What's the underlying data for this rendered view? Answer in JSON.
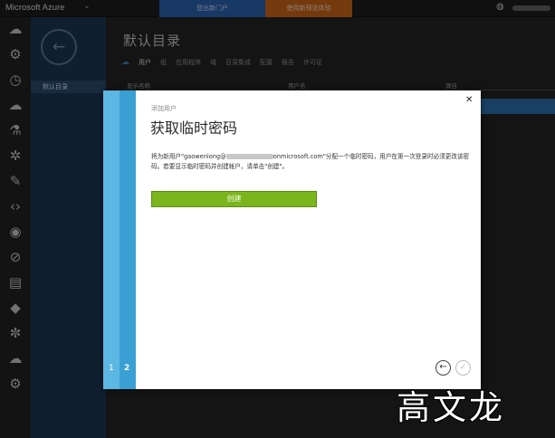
{
  "topbar": {
    "brand": "Microsoft Azure",
    "new_portal": "登出新门户",
    "preview": "使用新预览体验"
  },
  "nav": {
    "selected_item": "默认目录"
  },
  "main": {
    "title": "默认目录",
    "tabs": [
      "用户",
      "组",
      "应用程序",
      "域",
      "目录集成",
      "配置",
      "报告",
      "许可证"
    ],
    "active_tab": "用户",
    "grid_headers": [
      "显示名称",
      "用户名",
      "源自"
    ]
  },
  "dialog": {
    "kicker": "添加用户",
    "title": "获取临时密码",
    "body_part1": "将为新用户\"gaowenlong@",
    "body_part2": "onmicrosoft.com\"分配一个临时密码，用户在第一次登录时必须更改该密码。若要显示临时密码并创建帐户，请单击\"创建\"。",
    "create_button": "创建",
    "steps": [
      "1",
      "2"
    ]
  },
  "watermark": "高文龙",
  "colors": {
    "step_bar": "#3aa0d3",
    "create_button": "#7ab51d",
    "nav_pane": "#1d3957"
  }
}
